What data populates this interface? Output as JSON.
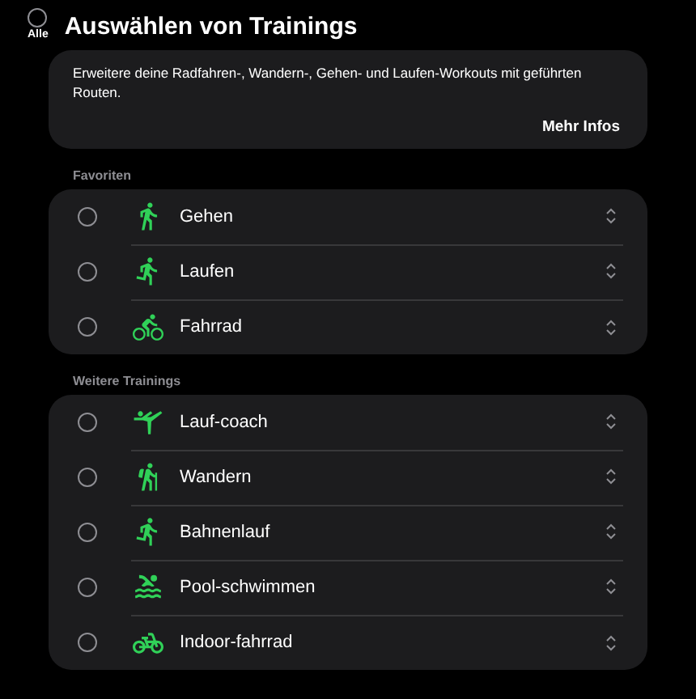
{
  "all_toggle": {
    "label": "Alle",
    "selected": false
  },
  "title": "Auswählen von Trainings",
  "info": {
    "text": "Erweitere deine Radfahren-, Wandern-, Gehen- und Laufen-Workouts mit geführten Routen.",
    "link": "Mehr Infos"
  },
  "sections": [
    {
      "heading": "Favoriten",
      "items": [
        {
          "label": "Gehen",
          "selected": false
        },
        {
          "label": "Laufen",
          "selected": false
        },
        {
          "label": "Fahrrad",
          "selected": false
        }
      ]
    },
    {
      "heading": "Weitere Trainings",
      "items": [
        {
          "label": "Lauf-coach",
          "selected": false
        },
        {
          "label": "Wandern",
          "selected": false
        },
        {
          "label": "Bahnenlauf",
          "selected": false
        },
        {
          "label": "Pool-schwimmen",
          "selected": false
        },
        {
          "label": "Indoor-fahrrad",
          "selected": false
        }
      ]
    }
  ]
}
